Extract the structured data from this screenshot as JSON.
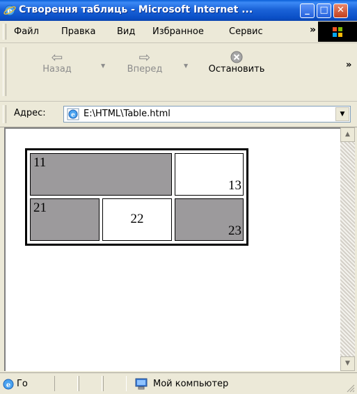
{
  "window": {
    "title": "Створення таблиць - Microsoft Internet ...",
    "min_label": "_",
    "max_label": "□",
    "close_label": "✕"
  },
  "menu": {
    "items": [
      "Файл",
      "Правка",
      "Вид",
      "Избранное",
      "Сервис"
    ],
    "overflow": "»"
  },
  "toolbar": {
    "back_label": "Назад",
    "forward_label": "Вперед",
    "stop_label": "Остановить",
    "overflow": "»"
  },
  "address": {
    "label": "Адрес:",
    "value": "E:\\HTML\\Table.html"
  },
  "table": {
    "rows": [
      [
        "11",
        "13"
      ],
      [
        "21",
        "22",
        "23"
      ]
    ],
    "gray_color": "#9c9a9c",
    "white_color": "#ffffff"
  },
  "status": {
    "text": "Го",
    "zone": "Мой компьютер"
  }
}
